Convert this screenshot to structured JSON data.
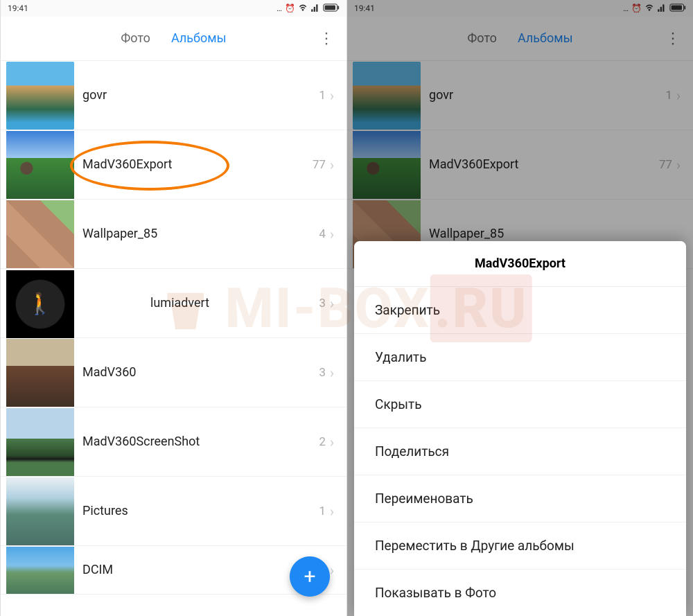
{
  "status_bar": {
    "time": "19:41"
  },
  "tabs": {
    "photos": "Фото",
    "albums": "Альбомы"
  },
  "albums": [
    {
      "name": "govr",
      "count": "1",
      "thumb": "thumb-govr"
    },
    {
      "name": "MadV360Export",
      "count": "77",
      "thumb": "thumb-madv360export"
    },
    {
      "name": "Wallpaper_85",
      "count": "4",
      "thumb": "thumb-wallpaper"
    },
    {
      "name": "lumiadvert",
      "count": "3",
      "thumb": "thumb-lumi"
    },
    {
      "name": "MadV360",
      "count": "3",
      "thumb": "thumb-madv360"
    },
    {
      "name": "MadV360ScreenShot",
      "count": "2",
      "thumb": "thumb-screenshot"
    },
    {
      "name": "Pictures",
      "count": "1",
      "thumb": "thumb-pictures"
    },
    {
      "name": "DCIM",
      "count": "",
      "thumb": "thumb-dcim"
    }
  ],
  "fab": "+",
  "sheet": {
    "title": "MadV360Export",
    "items": [
      "Закрепить",
      "Удалить",
      "Скрыть",
      "Поделиться",
      "Переименовать",
      "Переместить в Другие альбомы",
      "Показывать в Фото"
    ]
  },
  "watermark": {
    "text": "MI-BOX",
    "suffix": ".RU"
  }
}
